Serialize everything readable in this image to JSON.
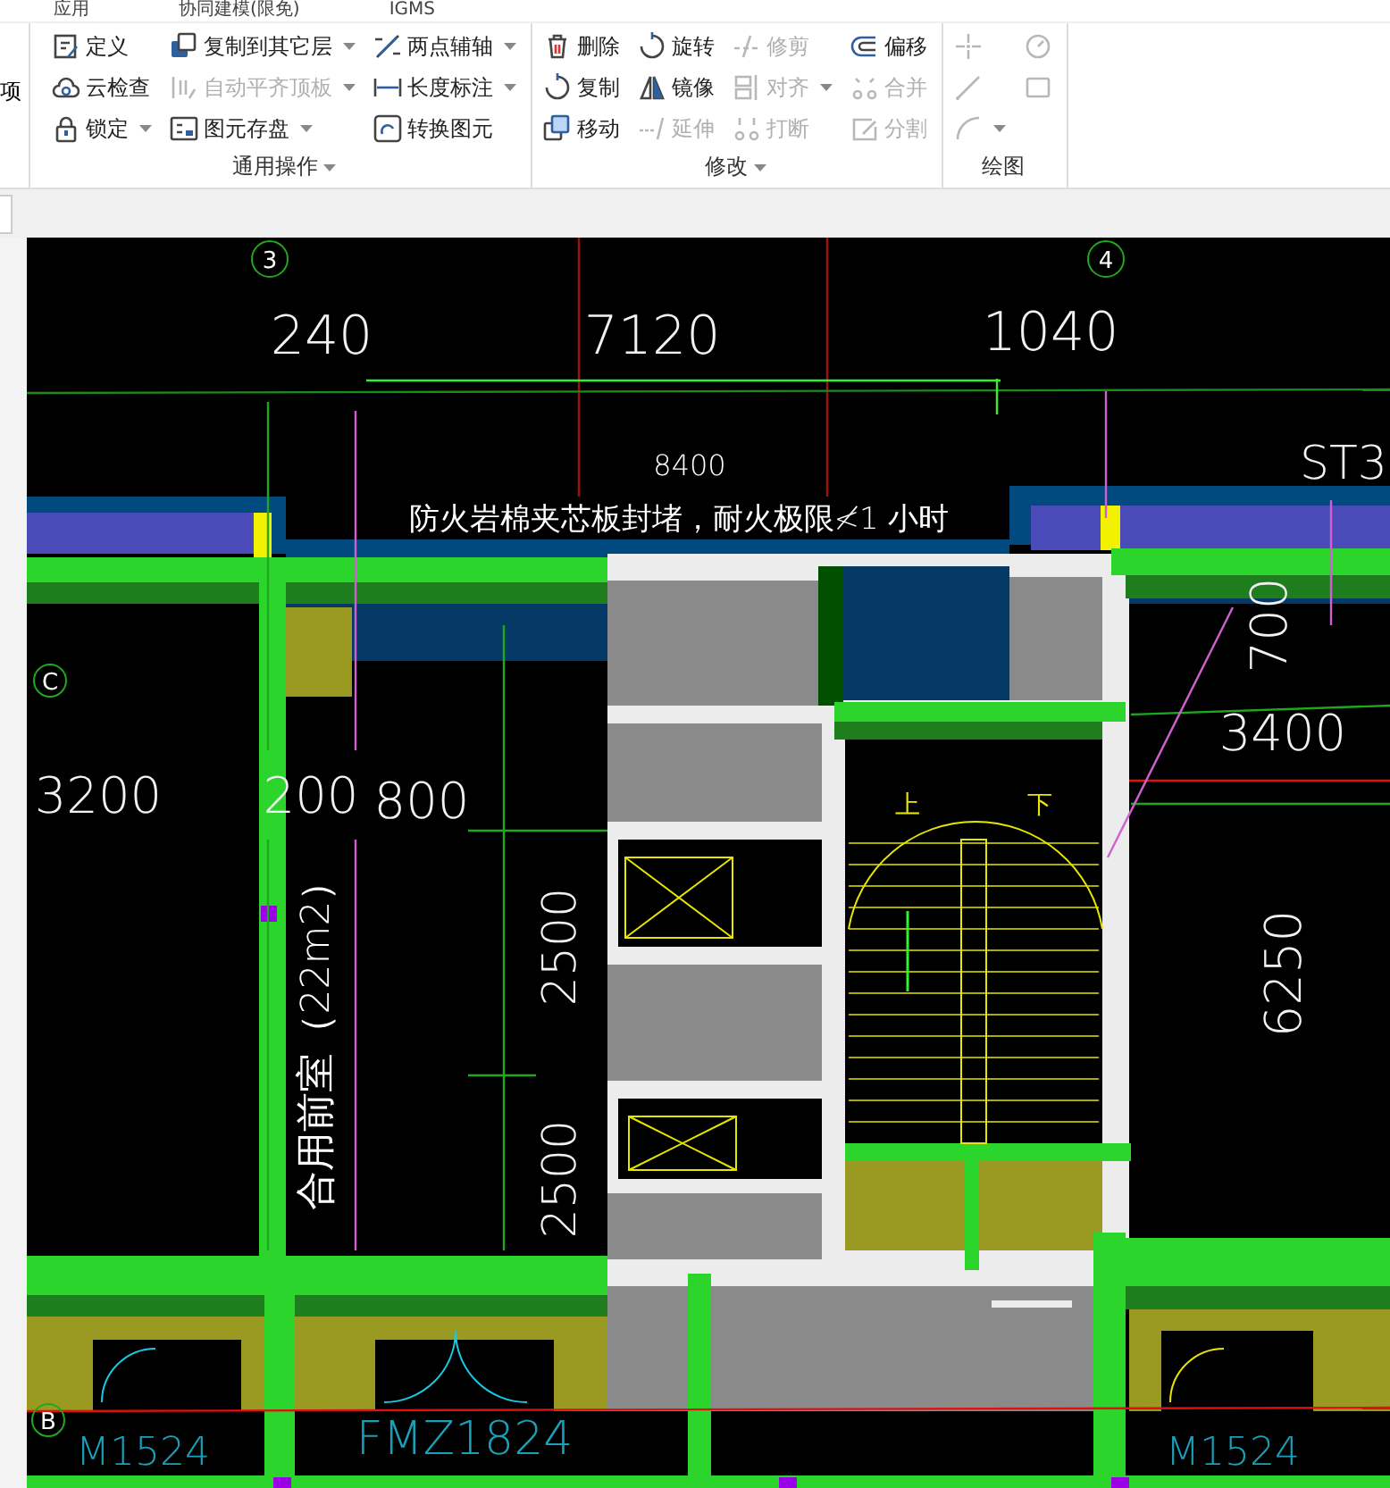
{
  "top_tabs": [
    {
      "label": "应用"
    },
    {
      "label": "协同建模(限免)"
    },
    {
      "label": "IGMS"
    }
  ],
  "side_label": "项",
  "ribbon_groups": [
    {
      "title": "通用操作",
      "menu": true,
      "columns": [
        [
          {
            "label": "定义",
            "disabled": false,
            "dropdown": false
          },
          {
            "label": "云检查",
            "disabled": false,
            "dropdown": false
          },
          {
            "label": "锁定",
            "disabled": false,
            "dropdown": true
          }
        ],
        [
          {
            "label": "复制到其它层",
            "disabled": false,
            "dropdown": true
          },
          {
            "label": "自动平齐顶板",
            "disabled": true,
            "dropdown": true
          },
          {
            "label": "图元存盘",
            "disabled": false,
            "dropdown": true
          }
        ],
        [
          {
            "label": "两点辅轴",
            "disabled": false,
            "dropdown": true
          },
          {
            "label": "长度标注",
            "disabled": false,
            "dropdown": true
          },
          {
            "label": "转换图元",
            "disabled": false,
            "dropdown": false
          }
        ]
      ]
    },
    {
      "title": "修改",
      "menu": true,
      "columns": [
        [
          {
            "label": "删除",
            "disabled": false,
            "dropdown": false
          },
          {
            "label": "复制",
            "disabled": false,
            "dropdown": false
          },
          {
            "label": "移动",
            "disabled": false,
            "dropdown": false
          }
        ],
        [
          {
            "label": "旋转",
            "disabled": false,
            "dropdown": false
          },
          {
            "label": "镜像",
            "disabled": false,
            "dropdown": false
          },
          {
            "label": "延伸",
            "disabled": true,
            "dropdown": false
          }
        ],
        [
          {
            "label": "修剪",
            "disabled": true,
            "dropdown": false
          },
          {
            "label": "对齐",
            "disabled": true,
            "dropdown": true
          },
          {
            "label": "打断",
            "disabled": true,
            "dropdown": false
          }
        ],
        [
          {
            "label": "偏移",
            "disabled": false,
            "dropdown": false
          },
          {
            "label": "合并",
            "disabled": true,
            "dropdown": false
          },
          {
            "label": "分割",
            "disabled": true,
            "dropdown": false
          }
        ]
      ]
    },
    {
      "title": "绘图",
      "menu": false,
      "columns": [
        [
          {
            "disabled": true,
            "dropdown": false
          },
          {
            "disabled": true,
            "dropdown": false
          },
          {
            "disabled": true,
            "dropdown": true
          }
        ],
        [
          {
            "disabled": true,
            "dropdown": false
          },
          {
            "disabled": true,
            "dropdown": false
          }
        ]
      ]
    }
  ],
  "drawing": {
    "axis_markers": [
      "3",
      "4",
      "C",
      "B"
    ],
    "texts": [
      {
        "text": "240",
        "kind": "dimension"
      },
      {
        "text": "7120",
        "kind": "dimension"
      },
      {
        "text": "1040",
        "kind": "dimension"
      },
      {
        "text": "8400",
        "kind": "note"
      },
      {
        "text": "防火岩棉夹芯板封堵，耐火极限≮1 小时",
        "kind": "note"
      },
      {
        "text": "ST3",
        "kind": "dimension"
      },
      {
        "text": "3200",
        "kind": "dimension"
      },
      {
        "text": "200",
        "kind": "dimension"
      },
      {
        "text": "800",
        "kind": "dimension"
      },
      {
        "text": "3400",
        "kind": "dimension"
      },
      {
        "text": "700",
        "kind": "dimension"
      },
      {
        "text": "合用前室（22m2）",
        "kind": "note"
      },
      {
        "text": "2500",
        "kind": "dimension"
      },
      {
        "text": "2500",
        "kind": "dimension"
      },
      {
        "text": "6250",
        "kind": "dimension"
      },
      {
        "text": "上",
        "kind": "stair"
      },
      {
        "text": "下",
        "kind": "stair"
      },
      {
        "text": "M1524",
        "kind": "door"
      },
      {
        "text": "FMZ1824",
        "kind": "door"
      },
      {
        "text": "M1524",
        "kind": "door"
      }
    ]
  }
}
